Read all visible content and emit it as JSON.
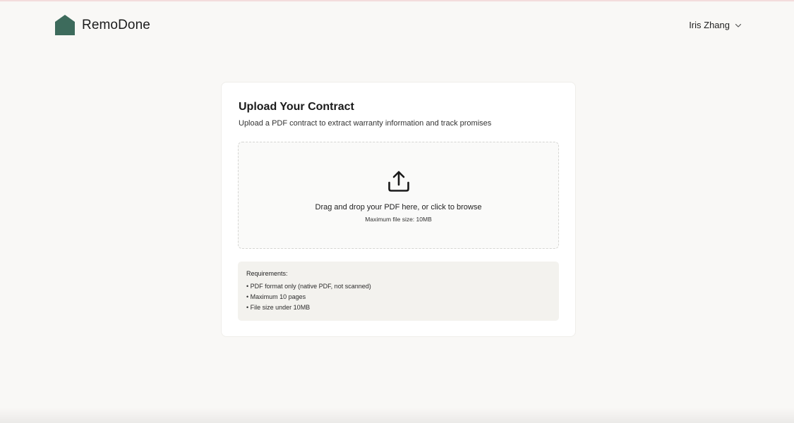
{
  "header": {
    "brand_name": "RemoDone",
    "brand_icon": "house-logo-icon",
    "user_name": "Iris Zhang",
    "user_menu_icon": "chevron-down-icon"
  },
  "upload_card": {
    "title": "Upload Your Contract",
    "subtitle": "Upload a PDF contract to extract warranty information and track promises",
    "dropzone": {
      "icon": "upload-icon",
      "primary_text": "Drag and drop your PDF here, or click to browse",
      "secondary_text": "Maximum file size: 10MB"
    },
    "requirements": {
      "heading": "Requirements:",
      "items": [
        "• PDF format only (native PDF, not scanned)",
        "• Maximum 10 pages",
        "• File size under 10MB"
      ]
    }
  },
  "colors": {
    "brand": "#3d6b5c",
    "background": "#f9f8f6",
    "card": "#ffffff",
    "requirements_bg": "#f3f2ee"
  }
}
